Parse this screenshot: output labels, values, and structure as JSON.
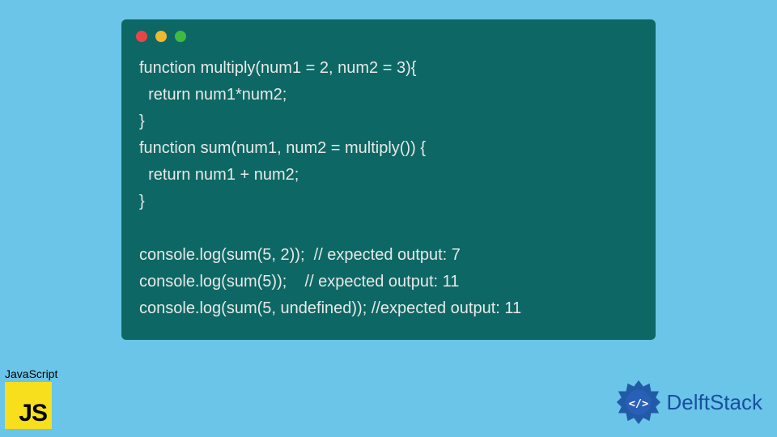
{
  "code_window": {
    "lines": [
      "function multiply(num1 = 2, num2 = 3){",
      "  return num1*num2;",
      "}",
      "function sum(num1, num2 = multiply()) {",
      "  return num1 + num2;",
      "}",
      "",
      "console.log(sum(5, 2));  // expected output: 7",
      "console.log(sum(5));    // expected output: 11",
      "console.log(sum(5, undefined)); //expected output: 11"
    ]
  },
  "js_badge": {
    "label": "JavaScript",
    "logo_text": "JS"
  },
  "delft_badge": {
    "text": "DelftStack"
  },
  "colors": {
    "background": "#6ac5e8",
    "code_bg": "#0d6865",
    "js_yellow": "#f7df1e",
    "delft_blue": "#1a4fa0"
  }
}
